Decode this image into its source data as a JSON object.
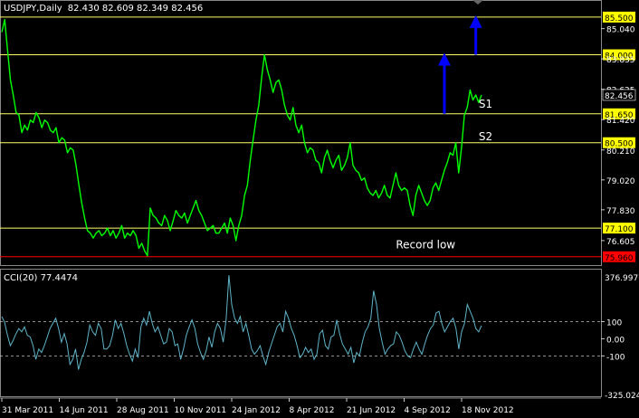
{
  "colors": {
    "background": "#000000",
    "price_line": "#00ff00",
    "hline": "#ffff66",
    "hline_label_bg": "#ffff00",
    "record_low_line": "#ff0000",
    "arrows": "#0000ff",
    "cci_line": "#5fb4c8",
    "grid": "#bfbfbf",
    "text": "#ffffff"
  },
  "chart_data": [
    {
      "type": "line",
      "title": "USDJPY,Daily",
      "ohlc": "82.430 82.609 82.349 82.456",
      "current_price_label": "82.456",
      "ylim": [
        75.7,
        86.0
      ],
      "y_tick_labels": [
        "85.040",
        "83.835",
        "82.625",
        "81.420",
        "80.210",
        "79.020",
        "77.830",
        "76.605"
      ],
      "y_ticks": [
        85.04,
        83.835,
        82.625,
        81.42,
        80.21,
        79.02,
        77.83,
        76.605
      ],
      "x_tick_labels": [
        "31 Mar 2011",
        "14 Jun 2011",
        "28 Aug 2011",
        "10 Nov 2011",
        "24 Jan 2012",
        "8 Apr 2012",
        "21 Jun 2012",
        "4 Sep 2012",
        "18 Nov 2012"
      ],
      "horizontal_lines": [
        {
          "value": 85.5,
          "label": "85.500",
          "color": "#ffff66"
        },
        {
          "value": 84.0,
          "label": "84.000",
          "color": "#ffff66"
        },
        {
          "value": 81.65,
          "label": "81.650",
          "color": "#ffff66"
        },
        {
          "value": 80.5,
          "label": "80.500",
          "color": "#ffff66"
        },
        {
          "value": 77.1,
          "label": "77.100",
          "color": "#ffff66"
        },
        {
          "value": 75.96,
          "label": "75.960",
          "color": "#ff0000"
        }
      ],
      "annotations": [
        {
          "text": "S1",
          "x_index": 167,
          "y": 81.9
        },
        {
          "text": "S2",
          "x_index": 167,
          "y": 80.6
        },
        {
          "text": "Record low",
          "x_index": 138,
          "y": 76.3
        }
      ],
      "arrows": [
        {
          "x_index": 155,
          "y_from": 81.65,
          "y_to": 84.0
        },
        {
          "x_index": 166,
          "y_from": 84.0,
          "y_to": 85.5
        }
      ],
      "series": [
        {
          "values": [
            84.9,
            85.4,
            84.2,
            83.0,
            82.4,
            81.7,
            81.6,
            80.9,
            81.2,
            81.0,
            81.4,
            81.3,
            81.7,
            81.5,
            81.1,
            81.4,
            81.3,
            81.0,
            80.9,
            81.1,
            80.5,
            80.7,
            80.6,
            80.1,
            80.3,
            80.2,
            79.6,
            78.8,
            78.1,
            77.5,
            77.0,
            76.9,
            76.7,
            76.9,
            77.0,
            76.8,
            76.9,
            77.1,
            76.8,
            77.0,
            76.7,
            76.9,
            77.2,
            76.7,
            76.9,
            76.8,
            77.0,
            76.8,
            76.3,
            76.5,
            76.2,
            76.0,
            77.9,
            77.6,
            77.5,
            77.3,
            77.2,
            77.6,
            77.4,
            77.0,
            77.4,
            77.8,
            77.6,
            77.5,
            77.7,
            77.3,
            77.6,
            77.9,
            78.2,
            77.8,
            77.6,
            77.3,
            77.0,
            77.1,
            77.2,
            76.9,
            76.9,
            77.1,
            77.3,
            76.9,
            77.5,
            77.2,
            76.6,
            77.2,
            77.6,
            78.4,
            78.8,
            79.8,
            80.6,
            81.4,
            82.0,
            83.1,
            84.0,
            83.4,
            83.0,
            82.5,
            82.9,
            83.0,
            82.6,
            82.0,
            81.6,
            81.4,
            81.9,
            81.2,
            80.9,
            81.2,
            80.5,
            80.1,
            80.3,
            80.2,
            79.8,
            79.7,
            79.3,
            79.9,
            80.2,
            79.8,
            79.5,
            79.8,
            80.0,
            79.4,
            79.6,
            79.9,
            80.5,
            79.6,
            79.4,
            79.3,
            79.0,
            79.1,
            78.7,
            78.5,
            78.4,
            78.6,
            78.3,
            78.5,
            78.8,
            78.4,
            78.3,
            78.8,
            79.3,
            78.8,
            78.6,
            78.7,
            78.6,
            78.0,
            77.6,
            78.4,
            78.8,
            78.5,
            78.2,
            78.0,
            78.2,
            78.7,
            78.9,
            78.6,
            79.0,
            79.4,
            79.7,
            80.1,
            80.0,
            80.5,
            79.3,
            80.3,
            81.6,
            81.9,
            82.6,
            82.2,
            82.4,
            82.1,
            82.4
          ]
        }
      ]
    },
    {
      "type": "line",
      "title": "CCI(20) 77.4474",
      "max_label": "376.9976",
      "min_label": "-325.0244",
      "ylim": [
        -325,
        377
      ],
      "y_tick_labels": [
        "100",
        "0.00",
        "-100"
      ],
      "y_ticks": [
        100,
        0,
        -100
      ],
      "series": [
        {
          "values": [
            130,
            95,
            20,
            -40,
            -10,
            30,
            60,
            40,
            70,
            20,
            10,
            -40,
            -120,
            -60,
            -80,
            -40,
            10,
            60,
            90,
            120,
            60,
            -20,
            30,
            -30,
            -150,
            -120,
            -60,
            -180,
            -120,
            -80,
            -20,
            80,
            40,
            20,
            90,
            60,
            -60,
            -60,
            -40,
            20,
            110,
            60,
            90,
            30,
            -40,
            -90,
            -130,
            -60,
            -110,
            70,
            120,
            80,
            160,
            90,
            40,
            70,
            20,
            -30,
            -20,
            60,
            40,
            -40,
            -30,
            -120,
            -60,
            20,
            70,
            110,
            60,
            -30,
            -80,
            -120,
            -70,
            10,
            -50,
            40,
            90,
            60,
            -20,
            110,
            370,
            200,
            120,
            90,
            130,
            40,
            90,
            20,
            -60,
            -90,
            -70,
            -40,
            -100,
            -150,
            -80,
            -30,
            20,
            70,
            90,
            40,
            160,
            120,
            60,
            20,
            -40,
            -110,
            -90,
            -50,
            -80,
            -60,
            -120,
            -90,
            30,
            50,
            -40,
            -60,
            10,
            20,
            110,
            30,
            -30,
            -60,
            -90,
            -50,
            -140,
            -80,
            -100,
            -20,
            40,
            70,
            120,
            280,
            200,
            60,
            -20,
            -90,
            -60,
            -40,
            -30,
            40,
            20,
            -20,
            -70,
            -100,
            -110,
            -60,
            -20,
            -60,
            -90,
            -30,
            20,
            60,
            80,
            150,
            160,
            90,
            40,
            70,
            100,
            120,
            60,
            -60,
            40,
            90,
            200,
            160,
            120,
            60,
            40,
            77
          ]
        }
      ]
    }
  ]
}
